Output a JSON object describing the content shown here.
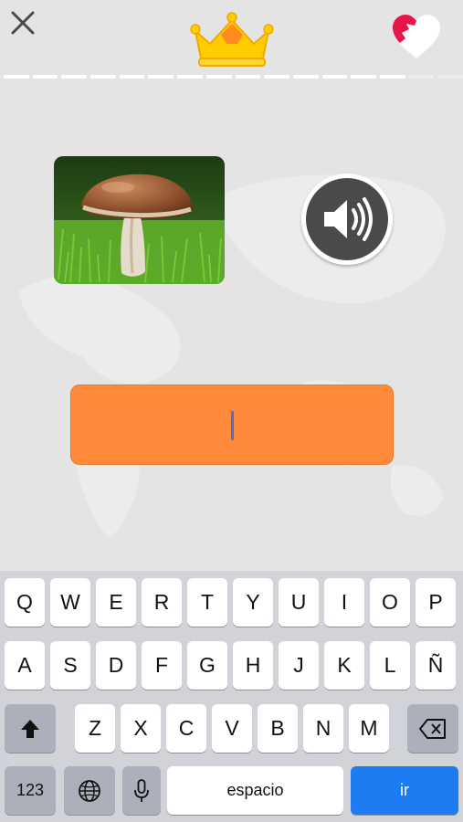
{
  "header": {
    "close_icon": "close-icon",
    "crown_icon": "crown-icon",
    "lives_icon": "heart-icon",
    "progress": {
      "completed": 14,
      "total": 16
    }
  },
  "question": {
    "image_icon": "mushroom-photo",
    "audio_icon": "speaker-icon",
    "answer_value": ""
  },
  "keyboard": {
    "row1": [
      "Q",
      "W",
      "E",
      "R",
      "T",
      "Y",
      "U",
      "I",
      "O",
      "P"
    ],
    "row2": [
      "A",
      "S",
      "D",
      "F",
      "G",
      "H",
      "J",
      "K",
      "L",
      "Ñ"
    ],
    "row3": [
      "Z",
      "X",
      "C",
      "V",
      "B",
      "N",
      "M"
    ],
    "numbers_label": "123",
    "space_label": "espacio",
    "go_label": "ir"
  },
  "colors": {
    "background": "#e4e4e4",
    "answer_field": "#ff8a3a",
    "go_key": "#1e7cf2",
    "crown": "#ffcc00",
    "heart": "#e8144a"
  }
}
